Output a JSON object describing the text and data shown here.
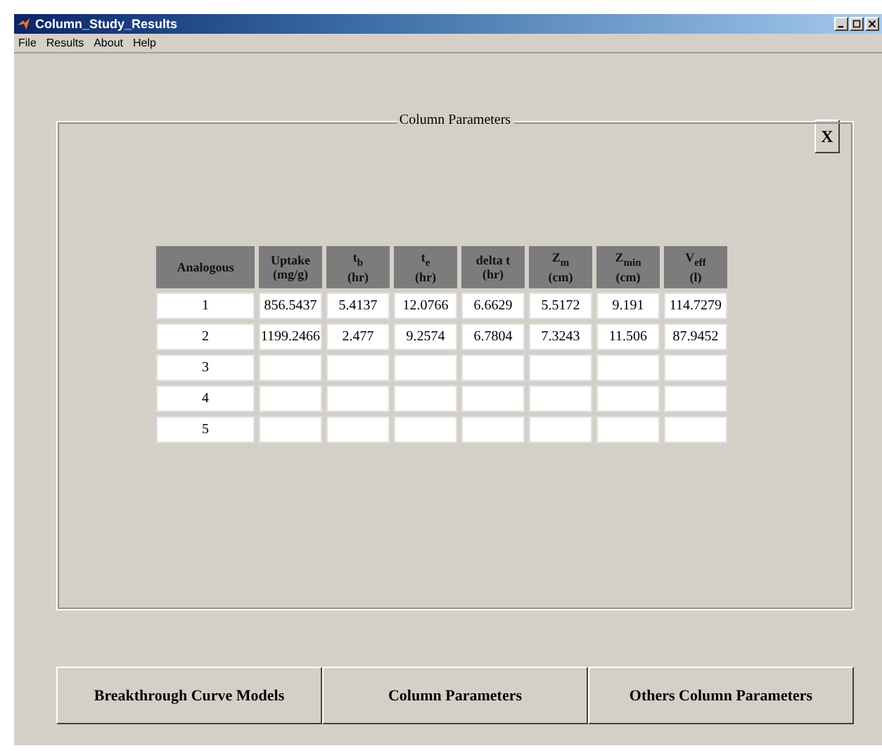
{
  "window": {
    "title": "Column_Study_Results"
  },
  "menu": [
    "File",
    "Results",
    "About",
    "Help"
  ],
  "panel": {
    "title": "Column Parameters",
    "close_button": "X",
    "table": {
      "columns": [
        {
          "label": "Analogous"
        },
        {
          "label": "Uptake",
          "unit": "(mg/g)"
        },
        {
          "label": "t$_{b}$",
          "unit": "(hr)"
        },
        {
          "label": "t$_{e}$",
          "unit": "(hr)"
        },
        {
          "label": "delta t",
          "unit": "(hr)"
        },
        {
          "label": "Z$_{m}$",
          "unit": "(cm)"
        },
        {
          "label": "Z$_{min}$",
          "unit": "(cm)"
        },
        {
          "label": "V$_{eff}$",
          "unit": "(l)"
        }
      ],
      "rows": [
        {
          "cells": [
            "1",
            "856.5437",
            "5.4137",
            "12.0766",
            "6.6629",
            "5.5172",
            "9.191",
            "114.7279"
          ]
        },
        {
          "cells": [
            "2",
            "1199.2466",
            "2.477",
            "9.2574",
            "6.7804",
            "7.3243",
            "11.506",
            "87.9452"
          ]
        },
        {
          "cells": [
            "3"
          ]
        },
        {
          "cells": [
            "4"
          ]
        },
        {
          "cells": [
            "5"
          ]
        }
      ]
    }
  },
  "buttons": [
    "Breakthrough Curve Models",
    "Column Parameters",
    "Others Column Parameters"
  ]
}
